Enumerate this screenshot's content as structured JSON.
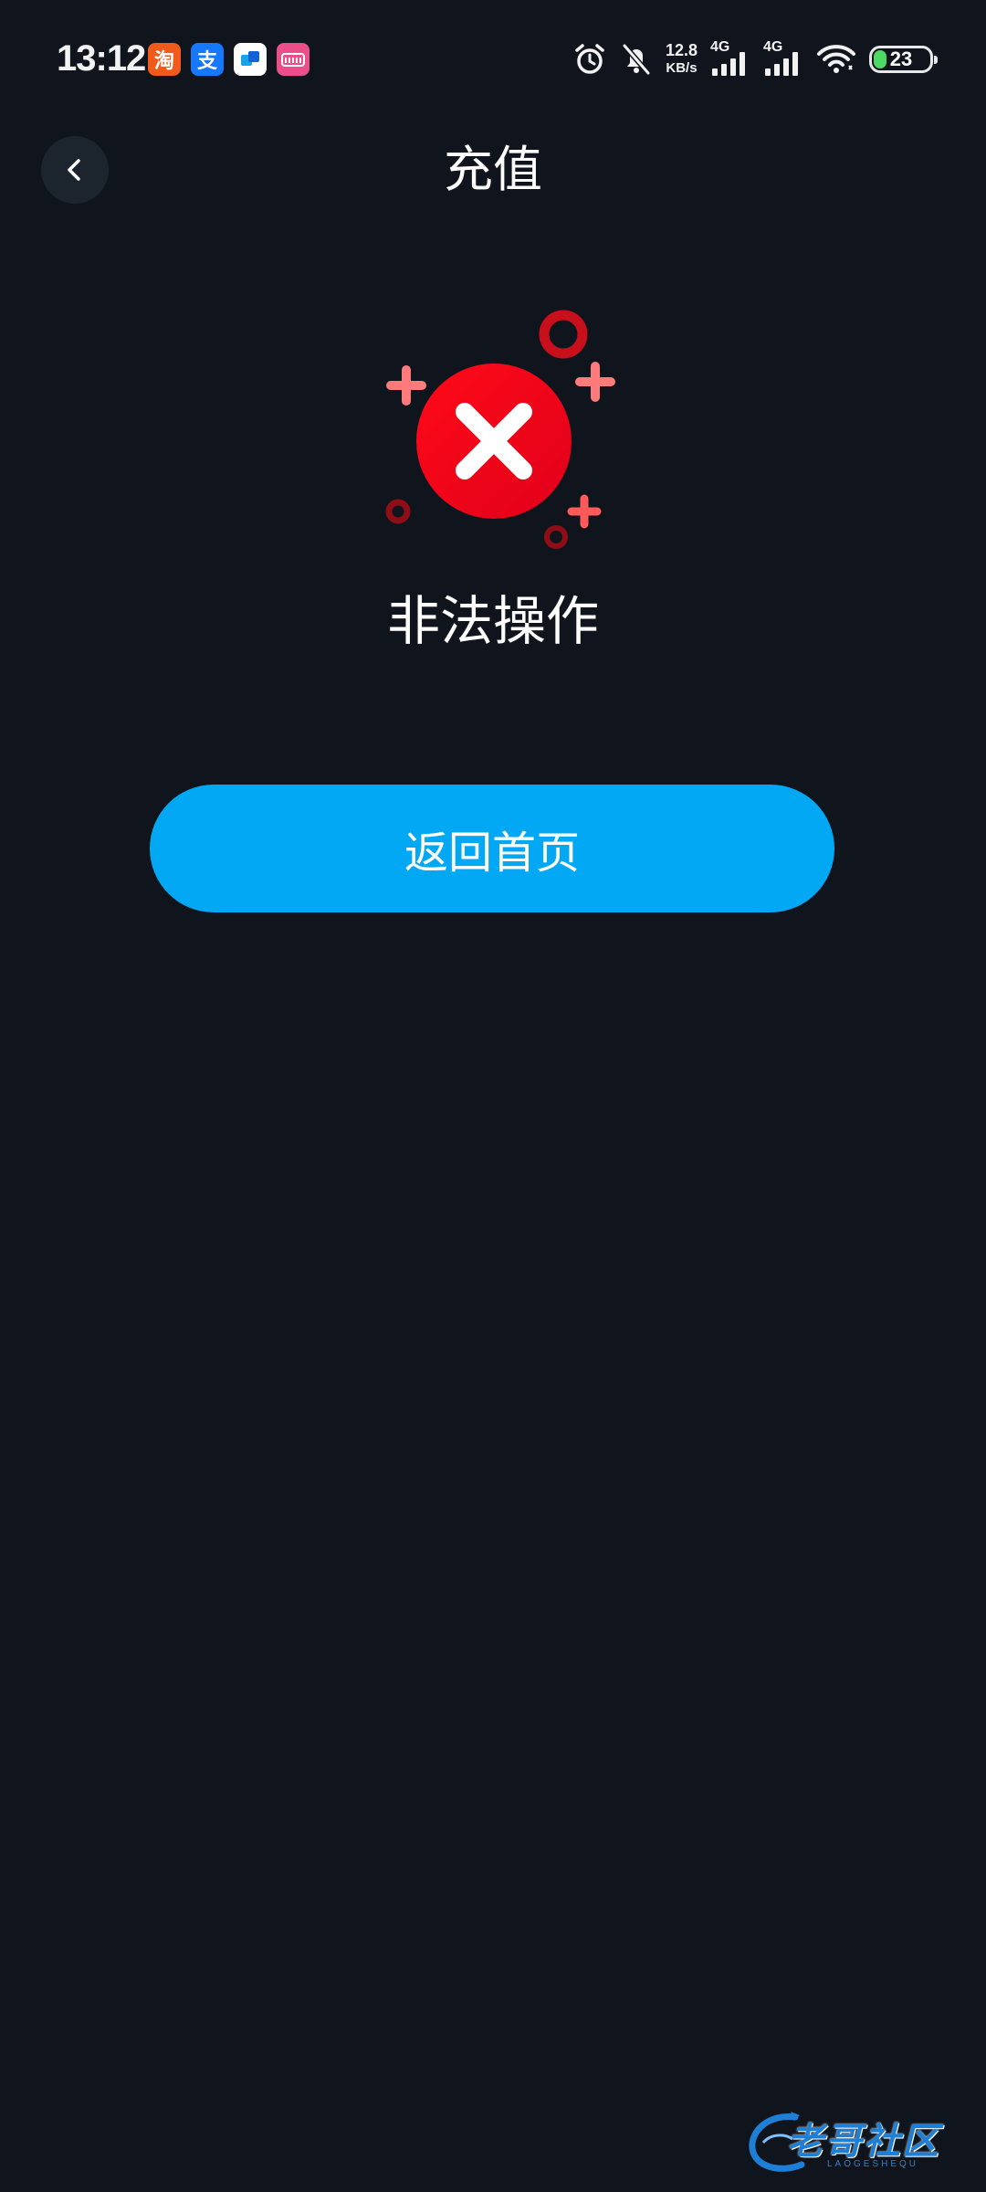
{
  "status_bar": {
    "time": "13:12",
    "notification_apps": [
      {
        "name": "taobao-app-icon",
        "glyph": "淘",
        "color": "#f05a1a"
      },
      {
        "name": "alipay-app-icon",
        "glyph": "支",
        "color": "#1677ff"
      },
      {
        "name": "blue-app-icon",
        "glyph": "",
        "color": "#ffffff"
      },
      {
        "name": "pink-app-icon",
        "glyph": "",
        "color": "#ea4f8a"
      }
    ],
    "icons": [
      "alarm-icon",
      "bell-off-icon",
      "signal-4g-icon",
      "signal-4g-icon",
      "wifi-icon",
      "battery-icon"
    ],
    "net_speed_value": "12.8",
    "net_speed_unit": "KB/s",
    "sim1_label": "4G",
    "sim2_label": "4G",
    "battery_level": "23",
    "battery_fraction": 0.23
  },
  "header": {
    "title": "充值",
    "back_icon": "chevron-left-icon"
  },
  "error": {
    "icon": "error-x-icon",
    "message": "非法操作",
    "accent_color": "#ff1020"
  },
  "actions": {
    "home_button_label": "返回首页",
    "home_button_color": "#03a8f4"
  },
  "watermark": {
    "text": "老哥社区",
    "sub": "LAOGESHEQU"
  }
}
